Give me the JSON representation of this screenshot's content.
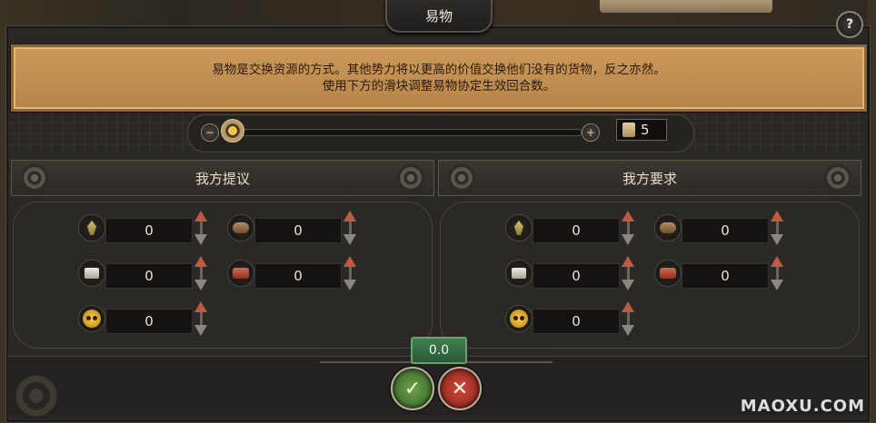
{
  "window": {
    "title": "易物",
    "help_label": "?"
  },
  "info": {
    "line1": "易物是交换资源的方式。其他势力将以更高的价值交换他们没有的货物，反之亦然。",
    "line2": "使用下方的滑块调整易物协定生效回合数。"
  },
  "slider": {
    "minus_label": "−",
    "plus_label": "+",
    "turns": "5",
    "position_fraction": 0
  },
  "offer": {
    "title": "我方提议",
    "items": [
      {
        "icon": "grain-icon",
        "value": "0"
      },
      {
        "icon": "wood-icon",
        "value": "0"
      },
      {
        "icon": "stone-icon",
        "value": "0"
      },
      {
        "icon": "cloth-icon",
        "value": "0"
      },
      {
        "icon": "gold-icon",
        "value": "0"
      }
    ]
  },
  "request": {
    "title": "我方要求",
    "items": [
      {
        "icon": "grain-icon",
        "value": "0"
      },
      {
        "icon": "wood-icon",
        "value": "0"
      },
      {
        "icon": "stone-icon",
        "value": "0"
      },
      {
        "icon": "cloth-icon",
        "value": "0"
      },
      {
        "icon": "gold-icon",
        "value": "0"
      }
    ]
  },
  "balance": "0.0",
  "buttons": {
    "accept_label": "✓",
    "reject_label": "✕"
  },
  "watermark": "MAOXU.COM",
  "colors": {
    "banner": "#c4914f",
    "accent_green": "#3f7f4f",
    "accent_red": "#b4352a",
    "gold": "#f4c34a"
  }
}
